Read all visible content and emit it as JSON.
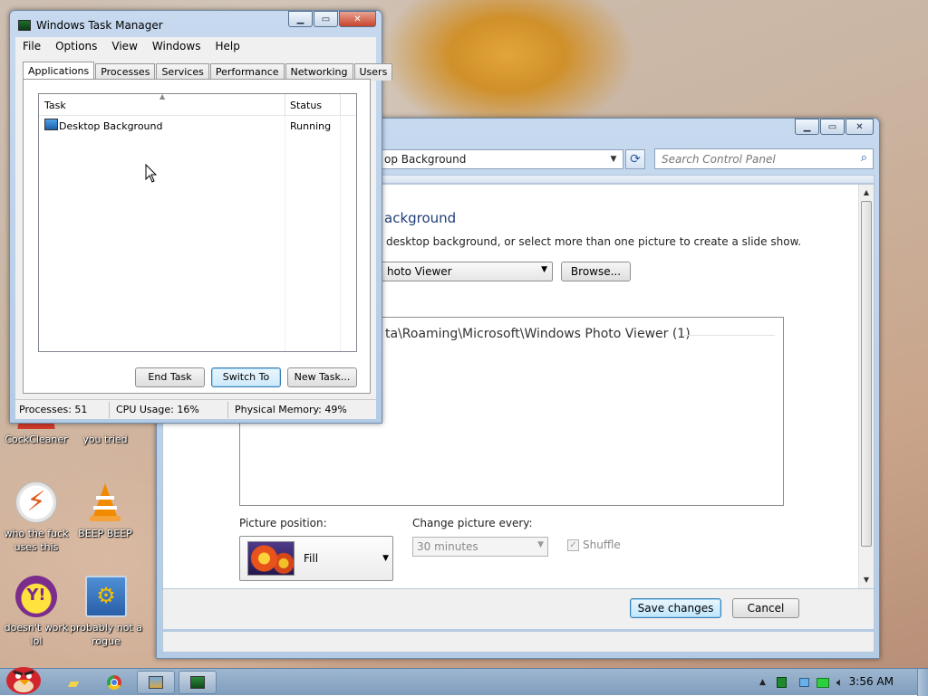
{
  "desktop": {
    "icons": [
      {
        "label": "CockCleaner"
      },
      {
        "label": "you tried"
      },
      {
        "label": "who the fuck uses this"
      },
      {
        "label": "BEEP BEEP"
      },
      {
        "label": "doesn't work lol"
      },
      {
        "label": "probably not a rogue"
      }
    ]
  },
  "task_manager": {
    "title": "Windows Task Manager",
    "menu": [
      "File",
      "Options",
      "View",
      "Windows",
      "Help"
    ],
    "tabs": [
      "Applications",
      "Processes",
      "Services",
      "Performance",
      "Networking",
      "Users"
    ],
    "active_tab": "Applications",
    "columns": [
      "Task",
      "Status"
    ],
    "rows": [
      {
        "task": "Desktop Background",
        "status": "Running"
      }
    ],
    "buttons": {
      "end_task": "End Task",
      "switch_to": "Switch To",
      "new_task": "New Task..."
    },
    "status": {
      "processes": "Processes: 51",
      "cpu": "CPU Usage: 16%",
      "memory": "Physical Memory: 49%"
    }
  },
  "control_panel": {
    "address": "op Background",
    "search_placeholder": "Search Control Panel",
    "heading": "ackground",
    "description": "desktop background, or select more than one picture to create a slide show.",
    "picture_location": "hoto Viewer",
    "browse_label": "Browse...",
    "folder_path": "ta\\Roaming\\Microsoft\\Windows Photo Viewer (1)",
    "picture_position_label": "Picture position:",
    "picture_position_value": "Fill",
    "change_every_label": "Change picture every:",
    "change_every_value": "30 minutes",
    "shuffle_label": "Shuffle",
    "shuffle_checked": true,
    "save_label": "Save changes",
    "cancel_label": "Cancel"
  },
  "taskbar": {
    "clock": "3:56 AM"
  }
}
